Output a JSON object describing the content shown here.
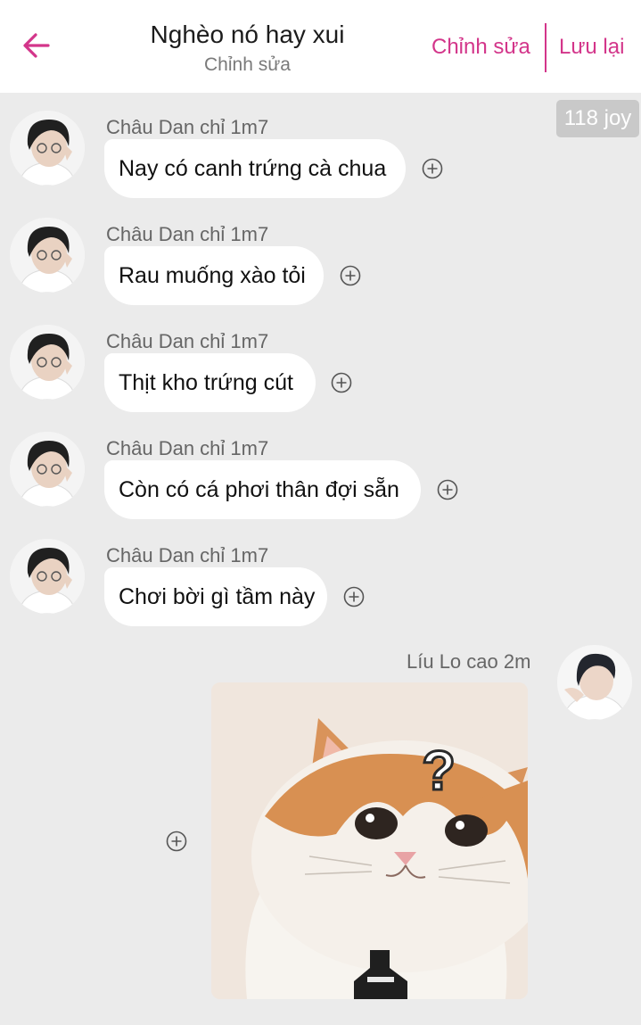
{
  "header": {
    "title": "Nghèo nó hay xui",
    "subtitle": "Chỉnh sửa",
    "edit_label": "Chỉnh sửa",
    "save_label": "Lưu lại",
    "accent_color": "#d3358a"
  },
  "score_badge": "118 joy",
  "messages": [
    {
      "sender": "Châu Dan chỉ 1m7",
      "text": "Nay có canh trứng cà chua"
    },
    {
      "sender": "Châu Dan chỉ 1m7",
      "text": "Rau muống xào tỏi"
    },
    {
      "sender": "Châu Dan chỉ 1m7",
      "text": "Thịt kho trứng cút"
    },
    {
      "sender": "Châu Dan chỉ 1m7",
      "text": "Còn có cá phơi thân đợi sẵn"
    },
    {
      "sender": "Châu Dan chỉ 1m7",
      "text": "Chơi bời gì tầm này"
    }
  ],
  "outgoing": {
    "sender": "Líu Lo cao 2m",
    "sticker": "confused-cat-sticker",
    "sticker_glyph": "?"
  },
  "icons": {
    "back": "arrow-left-icon",
    "react": "plus-circle-icon"
  }
}
